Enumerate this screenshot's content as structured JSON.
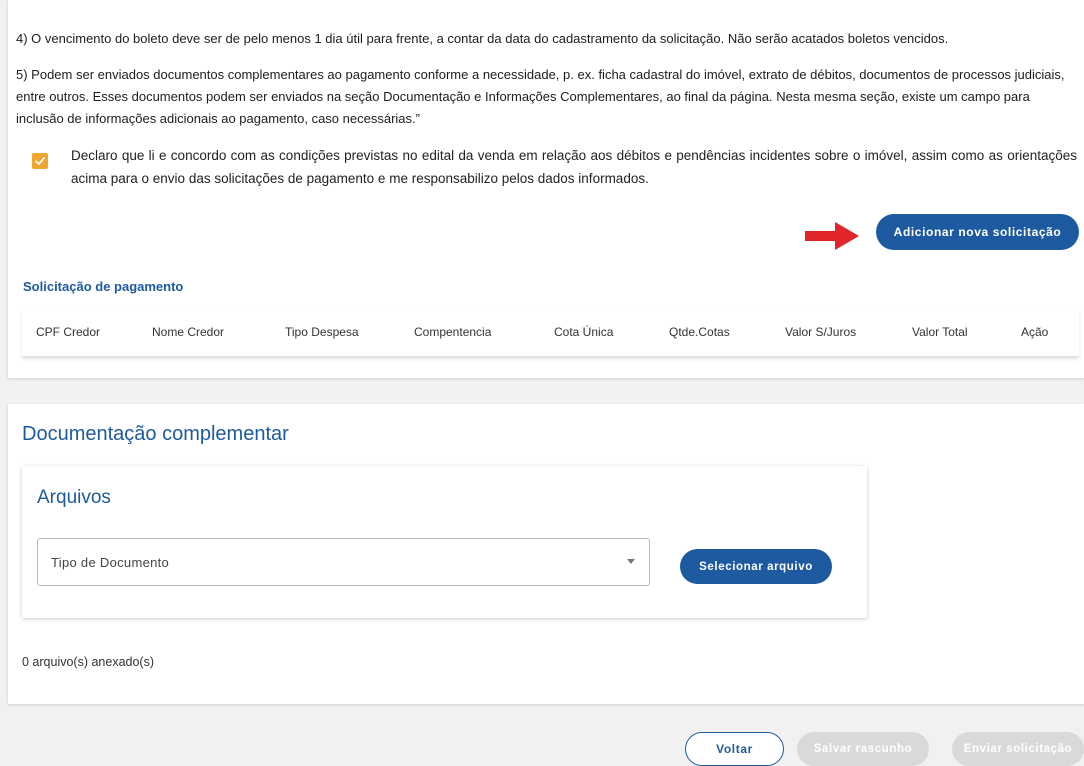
{
  "conditions": {
    "p4": "4) O vencimento do boleto deve ser de pelo menos 1 dia útil para frente, a contar da data do cadastramento da solicitação. Não serão acatados boletos vencidos.",
    "p5": "5) Podem ser enviados documentos complementares ao pagamento conforme a necessidade, p. ex. ficha cadastral do imóvel, extrato de débitos, documentos de processos judiciais, entre outros. Esses documentos podem ser enviados na seção Documentação e Informações Complementares, ao final da página. Nesta mesma seção, existe um campo para inclusão de informações adicionais ao pagamento, caso necessárias.”",
    "declaration": "Declaro que li e concordo com as condições previstas no edital da venda em relação aos débitos e pendências incidentes sobre o imóvel, assim como as orientações acima para o envio das solicitações de pagamento e me responsabilizo pelos dados informados.",
    "declaration_checked": true,
    "add_button": "Adicionar nova solicitação"
  },
  "payment_section": {
    "title": "Solicitação de pagamento",
    "columns": [
      "CPF Credor",
      "Nome Credor",
      "Tipo Despesa",
      "Compentencia",
      "Cota Única",
      "Qtde.Cotas",
      "Valor S/Juros",
      "Valor Total",
      "Ação"
    ]
  },
  "documentation": {
    "title": "Documentação complementar",
    "files_title": "Arquivos",
    "doc_type_placeholder": "Tipo de Documento",
    "select_file_button": "Selecionar arquivo",
    "attached_count": "0 arquivo(s) anexado(s)"
  },
  "footer": {
    "back": "Voltar",
    "save_draft": "Salvar rascunho",
    "send": "Enviar solicitação"
  },
  "colors": {
    "primary": "#1e5a9f",
    "checkbox": "#f0a531",
    "arrow": "#e0252b",
    "disabled": "#d9d9d9"
  }
}
